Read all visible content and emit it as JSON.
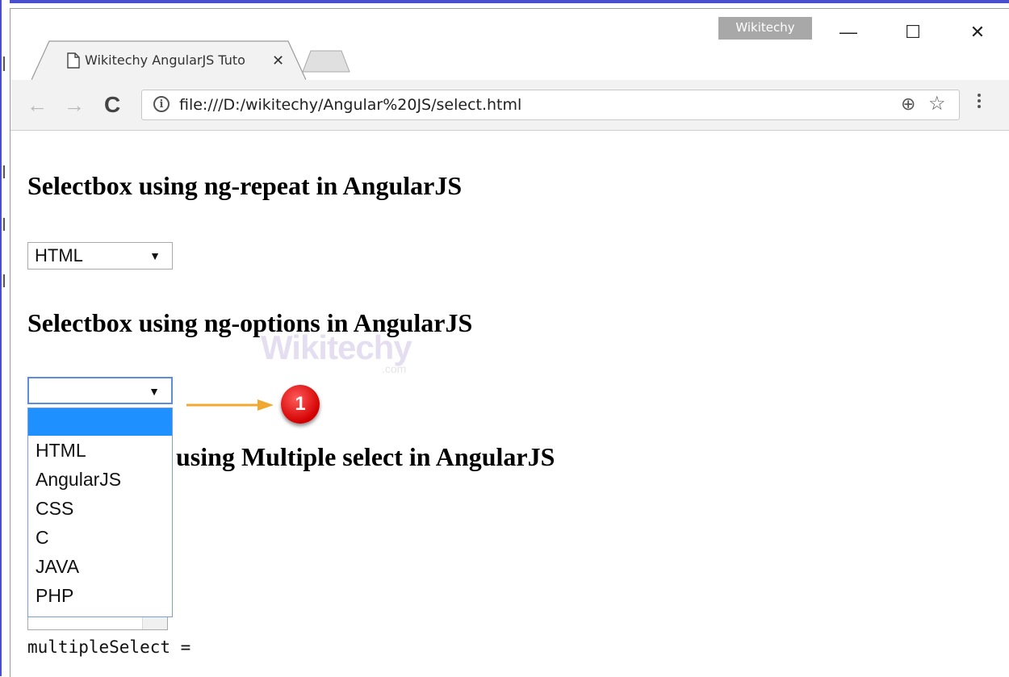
{
  "window": {
    "user_badge": "Wikitechy",
    "minimize_glyph": "—",
    "maximize_glyph": "☐",
    "close_glyph": "✕"
  },
  "tab": {
    "title": "Wikitechy AngularJS Tuto",
    "close_glyph": "✕"
  },
  "toolbar": {
    "back_glyph": "←",
    "forward_glyph": "→",
    "reload_glyph": "C",
    "info_glyph": "i",
    "url": "file:///D:/wikitechy/Angular%20JS/select.html",
    "zoom_glyph": "⊕",
    "star_glyph": "☆"
  },
  "page": {
    "heading1": "Selectbox using ng-repeat in AngularJS",
    "select1_value": "HTML",
    "heading2": "Selectbox using ng-options in AngularJS",
    "select2_value": "",
    "heading3_visible": "using Multiple select in AngularJS",
    "dropdown_arrow": "▼",
    "dropdown_options": [
      "",
      "HTML",
      "AngularJS",
      "CSS",
      "C",
      "JAVA",
      "PHP"
    ],
    "output_text": "multipleSelect =",
    "callout_number": "1",
    "watermark": "Wikitechy",
    "watermark_sub": ".com"
  },
  "colors": {
    "frame": "#4a4fd0",
    "highlight": "#1e90ff",
    "arrow": "#f0a830",
    "callout": "#d30000"
  }
}
